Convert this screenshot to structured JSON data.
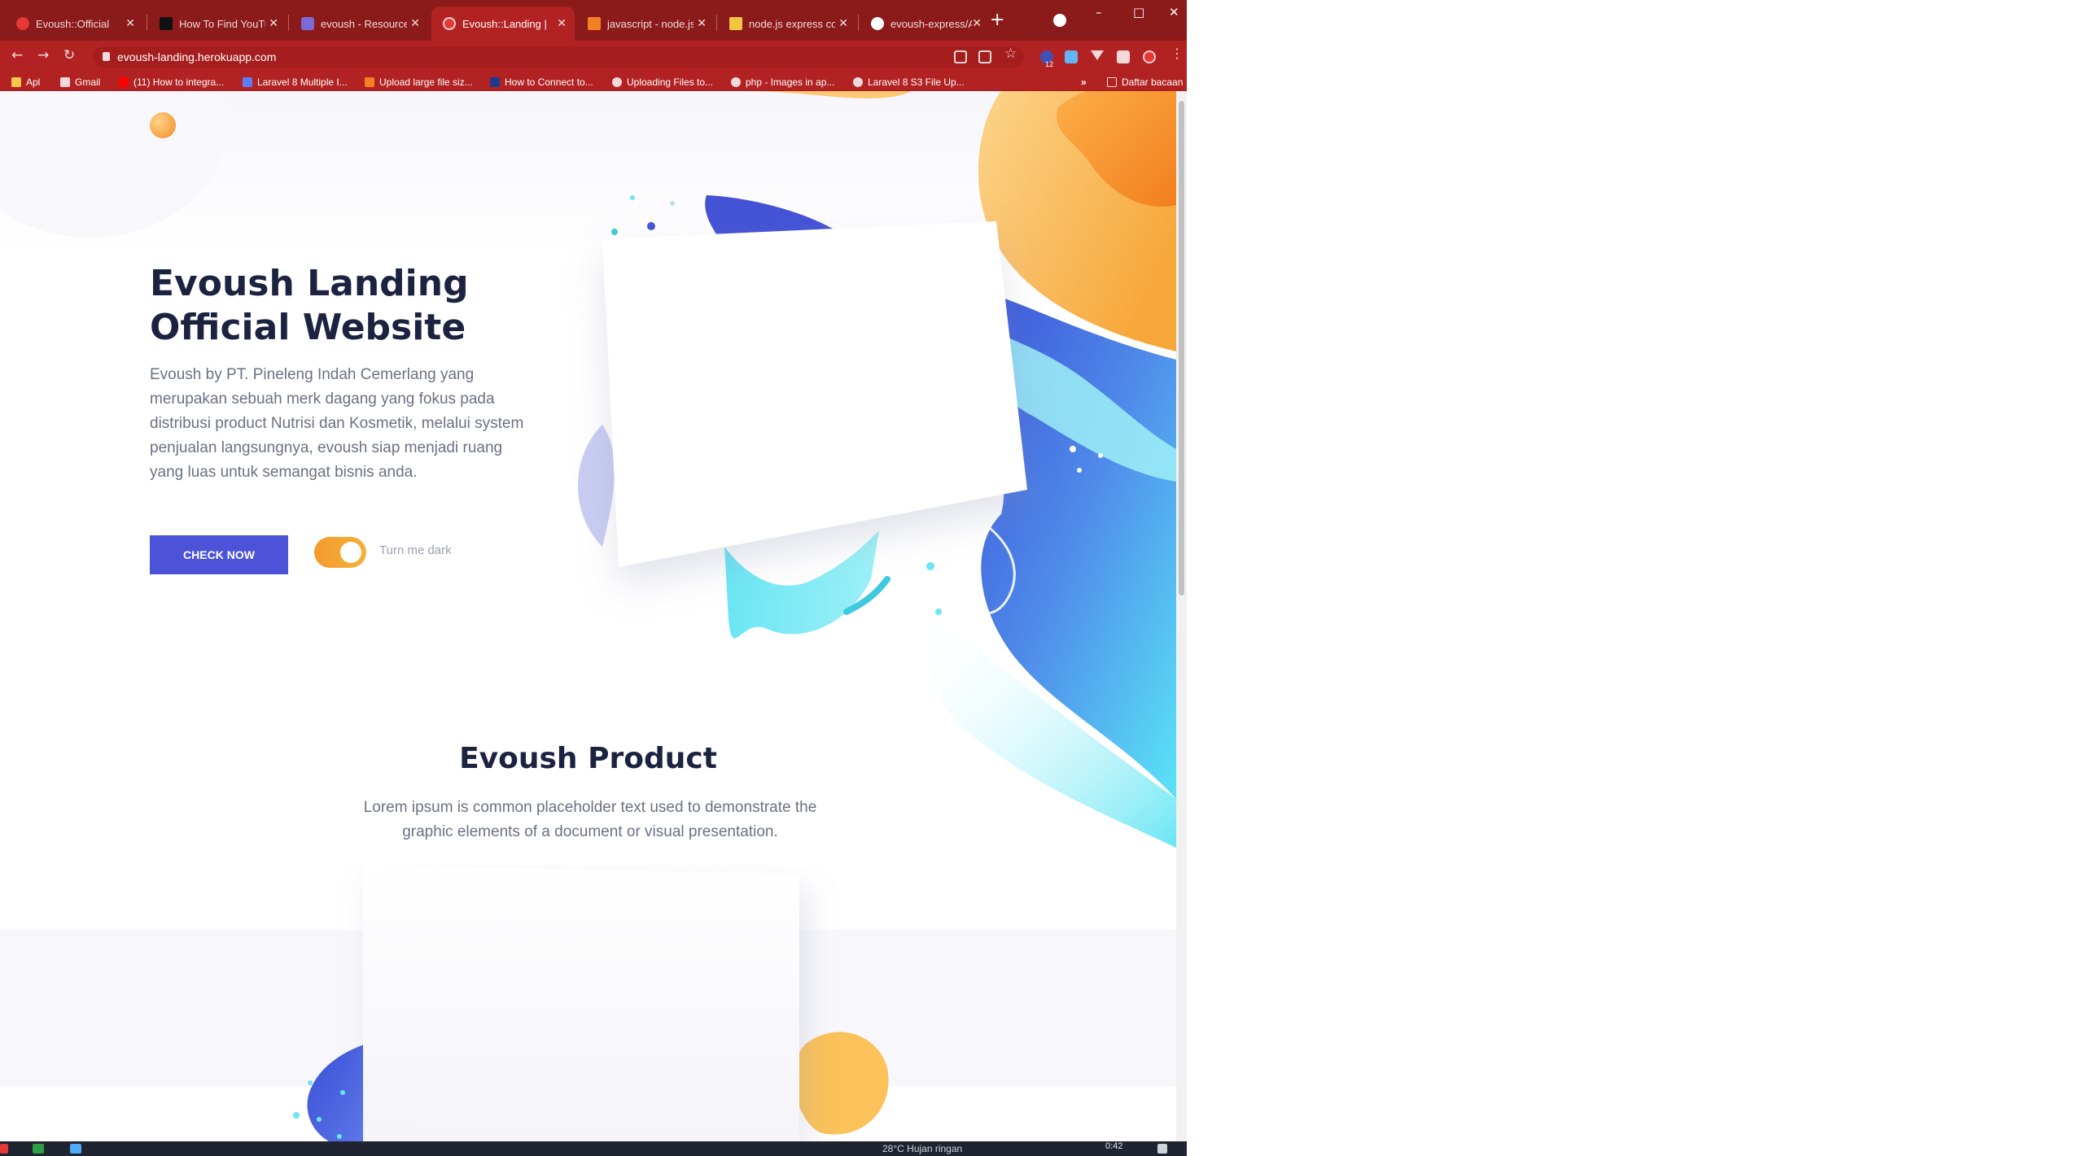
{
  "browser": {
    "tabs": [
      {
        "title": "Evoush::Official",
        "active": false,
        "favicon_color": "#e53935"
      },
      {
        "title": "How To Find YouTube",
        "active": false,
        "favicon_color": "#111111"
      },
      {
        "title": "evoush - Resources",
        "active": false,
        "favicon_color": "#7a6bd8"
      },
      {
        "title": "Evoush::Landing | Of",
        "active": true,
        "favicon_color": "#e53935"
      },
      {
        "title": "javascript - node.js",
        "active": false,
        "favicon_color": "#f48024"
      },
      {
        "title": "node.js express conn",
        "active": false,
        "favicon_color": "#f4c542"
      },
      {
        "title": "evoush-express/App",
        "active": false,
        "favicon_color": "#ffffff"
      }
    ],
    "new_tab_label": "+",
    "window_controls": {
      "minimize": "–",
      "maximize": "□",
      "close": "✕"
    },
    "address": "evoush-landing.herokuapp.com",
    "extension_badge": "12",
    "bookmarks": [
      {
        "label": "Apl",
        "icon": "apps-grid-icon"
      },
      {
        "label": "Gmail",
        "icon": "gmail-icon"
      },
      {
        "label": "(11) How to integra...",
        "icon": "youtube-icon"
      },
      {
        "label": "Laravel 8 Multiple I...",
        "icon": "laravel-icon"
      },
      {
        "label": "Upload large file siz...",
        "icon": "stackoverflow-icon"
      },
      {
        "label": "How to Connect to...",
        "icon": "site-icon"
      },
      {
        "label": "Uploading Files to...",
        "icon": "globe-icon"
      },
      {
        "label": "php - Images in ap...",
        "icon": "globe-icon"
      },
      {
        "label": "Laravel 8 S3 File Up...",
        "icon": "globe-icon"
      }
    ],
    "bookmarks_more": "»",
    "reading_list_label": "Daftar bacaan"
  },
  "page": {
    "hero_title_line1": "Evoush Landing",
    "hero_title_line2": "Official Website",
    "hero_description": "Evoush by PT. Pineleng Indah Cemerlang yang merupakan sebuah merk dagang yang fokus pada distribusi product Nutrisi dan Kosmetik, melalui system penjualan langsungnya, evoush siap menjadi ruang yang luas untuk semangat bisnis anda.",
    "cta_label": "CHECK NOW",
    "toggle_label": "Turn me dark",
    "toggle_on": true,
    "product_title": "Evoush Product",
    "product_description": "Lorem ipsum is common placeholder text used to demonstrate the graphic elements of a document or visual presentation."
  },
  "taskbar": {
    "weather": "28°C  Hujan ringan",
    "time": "0:42"
  },
  "colors": {
    "tab_strip": "#8b1a1a",
    "toolbar": "#b22222",
    "accent_blue": "#4c53d8",
    "accent_orange": "#f5a030",
    "heading": "#1c2340",
    "body_text": "#6b7184"
  }
}
